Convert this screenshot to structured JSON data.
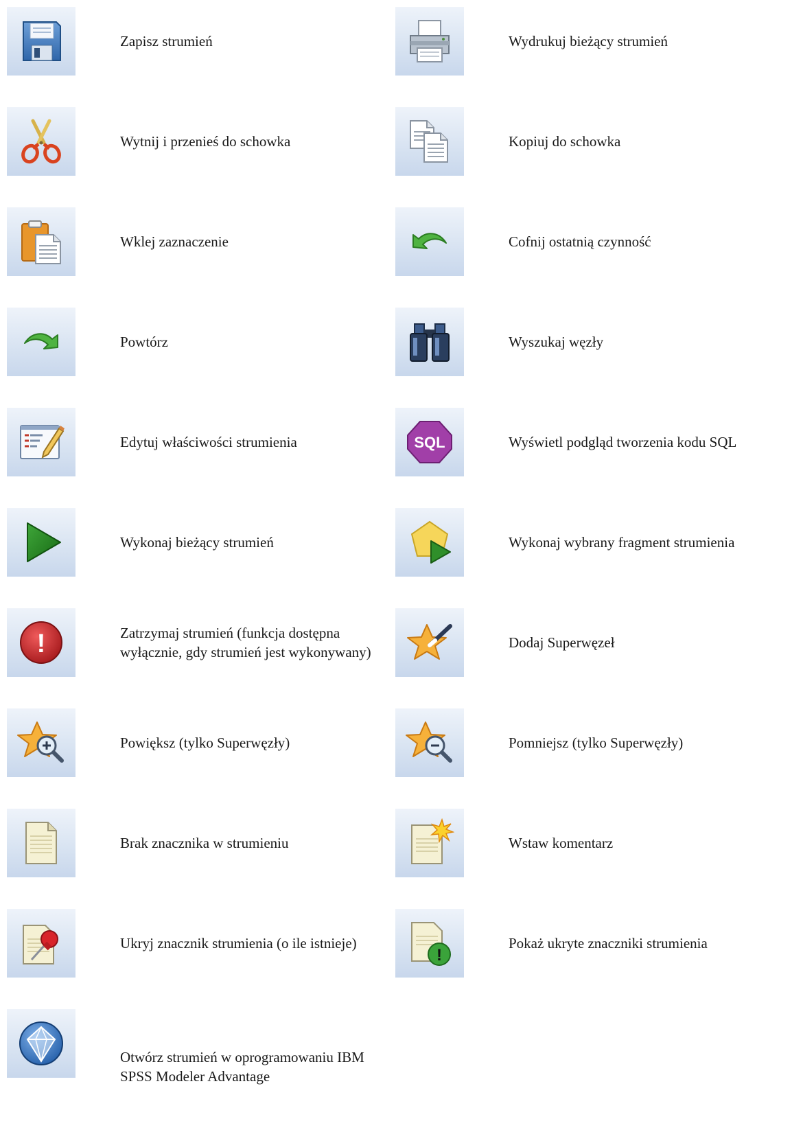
{
  "toolbar_legend": {
    "items": [
      {
        "icon": "save-icon",
        "label": "Zapisz strumień"
      },
      {
        "icon": "print-icon",
        "label": "Wydrukuj bieżący strumień"
      },
      {
        "icon": "scissors-icon",
        "label": "Wytnij i przenieś do schowka"
      },
      {
        "icon": "copy-icon",
        "label": "Kopiuj do schowka"
      },
      {
        "icon": "paste-icon",
        "label": "Wklej zaznaczenie"
      },
      {
        "icon": "undo-icon",
        "label": "Cofnij ostatnią czynność"
      },
      {
        "icon": "redo-icon",
        "label": "Powtórz"
      },
      {
        "icon": "binoculars-icon",
        "label": "Wyszukaj węzły"
      },
      {
        "icon": "edit-properties-icon",
        "label": "Edytuj właściwości strumienia"
      },
      {
        "icon": "sql-icon",
        "label": "Wyświetl podgląd tworzenia kodu SQL",
        "icon_text": "SQL"
      },
      {
        "icon": "run-icon",
        "label": "Wykonaj bieżący strumień"
      },
      {
        "icon": "run-selection-icon",
        "label": "Wykonaj wybrany fragment strumienia"
      },
      {
        "icon": "stop-icon",
        "label": "Zatrzymaj strumień (funkcja dostępna wyłącznie, gdy strumień jest wykonywany)",
        "icon_text": "!"
      },
      {
        "icon": "add-supernode-icon",
        "label": "Dodaj Superwęzeł"
      },
      {
        "icon": "zoom-in-supernode-icon",
        "label": "Powiększ (tylko Superwęzły)"
      },
      {
        "icon": "zoom-out-supernode-icon",
        "label": "Pomniejsz (tylko Superwęzły)"
      },
      {
        "icon": "no-markup-icon",
        "label": "Brak znacznika w strumieniu"
      },
      {
        "icon": "insert-comment-icon",
        "label": "Wstaw komentarz"
      },
      {
        "icon": "hide-markup-icon",
        "label": "Ukryj znacznik strumienia (o ile istnieje)"
      },
      {
        "icon": "show-hidden-markup-icon",
        "label": "Pokaż ukryte znaczniki strumienia",
        "icon_text": "!"
      },
      {
        "icon": "modeler-advantage-icon",
        "label": "Otwórz strumień w oprogramowaniu IBM SPSS Modeler Advantage"
      }
    ]
  }
}
